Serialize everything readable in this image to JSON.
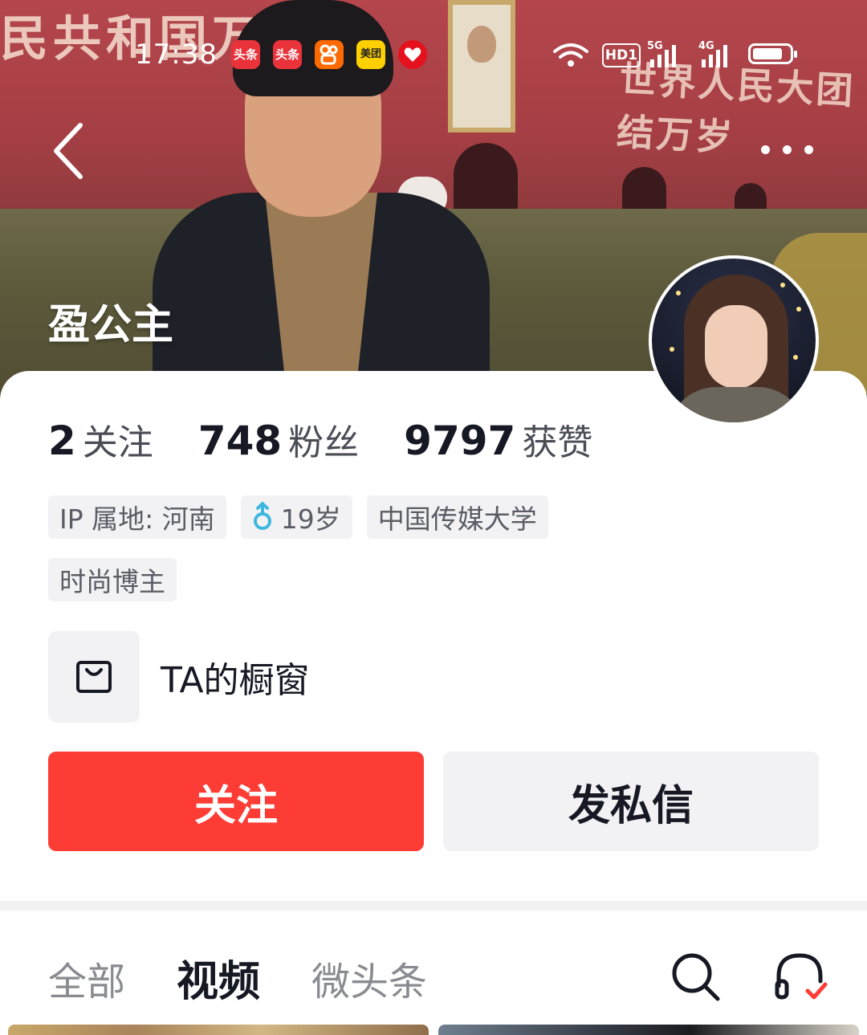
{
  "status_bar": {
    "time": "17:38",
    "apps": [
      {
        "icon": "toutiao-lite-icon",
        "label": "头条",
        "color": "#e9323a"
      },
      {
        "icon": "toutiao-icon",
        "label": "头条",
        "color": "#e9323a"
      },
      {
        "icon": "kuaishou-icon",
        "label": "",
        "color": "#ff6a00"
      },
      {
        "icon": "meituan-icon",
        "label": "美团",
        "color": "#ffd000"
      },
      {
        "icon": "pinduoduo-icon",
        "label": "",
        "color": "#e5111d"
      }
    ],
    "hd": "HD1",
    "signal_labels": [
      "5G",
      "4G"
    ]
  },
  "header": {
    "banner_text": "民共和国万",
    "banner_right": "世界人民大团结万岁",
    "back_icon": "chevron-left-icon",
    "more_icon": "more-dots-icon"
  },
  "profile": {
    "name": "盈公主",
    "stats": [
      {
        "value": "2",
        "label": "关注"
      },
      {
        "value": "748",
        "label": "粉丝"
      },
      {
        "value": "9797",
        "label": "获赞"
      }
    ],
    "tags": [
      {
        "text": "IP 属地: 河南",
        "icon": ""
      },
      {
        "text": "19岁",
        "icon": "male-gender-icon"
      },
      {
        "text": "中国传媒大学",
        "icon": ""
      },
      {
        "text": "时尚博主",
        "icon": ""
      }
    ],
    "shop": {
      "label": "TA的橱窗",
      "icon": "shopping-bag-icon"
    }
  },
  "actions": {
    "follow_label": "关注",
    "message_label": "发私信",
    "follow_color": "#fe3c36"
  },
  "tabs": {
    "items": [
      {
        "label": "全部",
        "active": false
      },
      {
        "label": "视频",
        "active": true
      },
      {
        "label": "微头条",
        "active": false
      }
    ],
    "search_icon": "search-icon",
    "listen_icon": "headphones-icon"
  }
}
